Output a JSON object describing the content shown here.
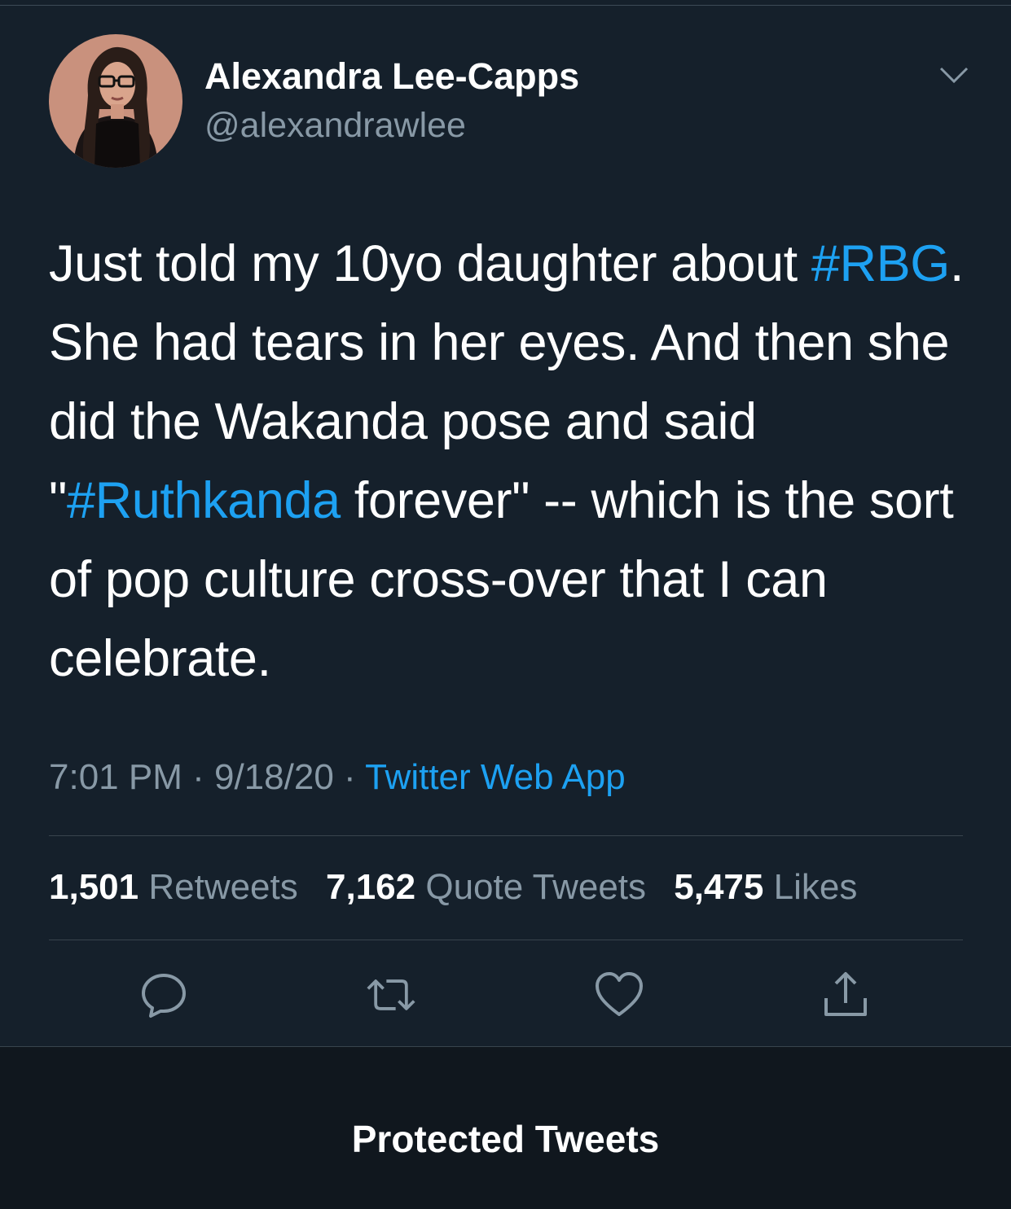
{
  "author": {
    "name": "Alexandra Lee-Capps",
    "handle": "@alexandrawlee",
    "avatar_icon": "profile-photo"
  },
  "tweet": {
    "text_segments": [
      {
        "text": "Just told my 10yo daughter about ",
        "type": "text"
      },
      {
        "text": "#RBG",
        "type": "hashtag"
      },
      {
        "text": ". She had tears in her eyes. And then she did the Wakanda pose and said \"",
        "type": "text"
      },
      {
        "text": "#Ruthkanda",
        "type": "hashtag"
      },
      {
        "text": " forever\" -- which is the sort of pop culture cross-over that I can celebrate.",
        "type": "text"
      }
    ]
  },
  "meta": {
    "time": "7:01 PM",
    "separator": " · ",
    "date": "9/18/20",
    "source": "Twitter Web App"
  },
  "stats": {
    "retweets_count": "1,501",
    "retweets_label": "Retweets",
    "quotes_count": "7,162",
    "quotes_label": "Quote Tweets",
    "likes_count": "5,475",
    "likes_label": "Likes"
  },
  "actions": [
    "reply-icon",
    "retweet-icon",
    "like-icon",
    "share-icon"
  ],
  "footer": {
    "title": "Protected Tweets"
  },
  "colors": {
    "background": "#15202b",
    "footer_background": "#10171e",
    "accent": "#1da1f2",
    "secondary_text": "#8899a6"
  }
}
